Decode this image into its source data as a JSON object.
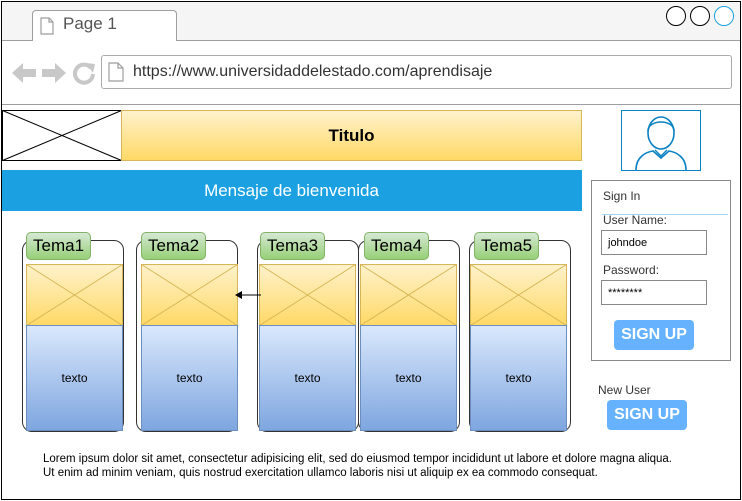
{
  "browser": {
    "tab_title": "Page 1",
    "url": "https://www.universidaddelestado.com/aprendisaje",
    "window_controls": [
      "minimize-icon",
      "maximize-icon",
      "close-icon"
    ],
    "nav_icons": [
      "back-arrow-icon",
      "forward-arrow-icon",
      "reload-icon",
      "page-icon"
    ]
  },
  "header": {
    "title": "Titulo",
    "welcome": "Mensaje de bienvenida"
  },
  "topics": [
    {
      "label": "Tema1",
      "body": "texto"
    },
    {
      "label": "Tema2",
      "body": "texto"
    },
    {
      "label": "Tema3",
      "body": "texto"
    },
    {
      "label": "Tema4",
      "body": "texto"
    },
    {
      "label": "Tema5",
      "body": "texto"
    }
  ],
  "signin": {
    "heading": "Sign In",
    "username_label": "User Name:",
    "username_value": "johndoe",
    "password_label": "Password:",
    "password_value": "********",
    "submit_label": "SIGN UP"
  },
  "new_user": {
    "label": "New User",
    "button_label": "SIGN UP"
  },
  "footer": {
    "line1": "Lorem ipsum dolor sit amet, consectetur adipisicing elit, sed do eiusmod tempor incididunt ut labore et dolore magna aliqua.",
    "line2": "Ut enim ad minim veniam, quis nostrud exercitation ullamco laboris nisi ut aliquip ex ea commodo consequat."
  },
  "colors": {
    "accent_blue": "#1ba1e2",
    "button_blue": "#66b2ff",
    "yellow": "#ffd966",
    "green": "#97d077",
    "light_blue": "#7ea6e0"
  }
}
